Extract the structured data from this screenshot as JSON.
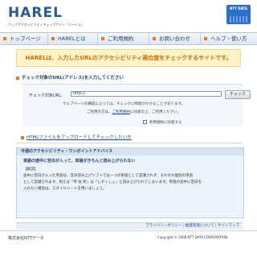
{
  "header": {
    "logo_text": "HAREL",
    "logo_subtitle": "ウェブアクセシビリティチェックサイト「ハーレル」",
    "brand_mark_text": "NTT DATA"
  },
  "nav": {
    "items": [
      {
        "label": "トップページ"
      },
      {
        "label": "HARELとは"
      },
      {
        "label": "ご利用規約"
      },
      {
        "label": "お問い合わせ"
      },
      {
        "label": "ヘルプ・使い方"
      }
    ]
  },
  "banner": {
    "text": "HARELは、入力したURLのアクセシビリティ適合度をチェックするサイトです。"
  },
  "url_form": {
    "heading": "チェック対象のURL(アドレス)を入力してください",
    "label": "チェック対象URL:",
    "value": "http://",
    "button_label": "チェック",
    "note1": "ウェブページの構成によっては、チェックに時間がかかることがあります。",
    "note2_prefix": "ご利用の方は、",
    "note2_link": "ご利用規約",
    "note2_suffix": "に同意の上、ご利用ください。",
    "agree_label": "利用規約に同意する"
  },
  "upload_link": {
    "text": "HTMLファイルをアップロードしてチェックしたい方"
  },
  "advice": {
    "heading": "今週のアクセシビリティ・ワンポイントアドバイス",
    "title": "単語の途中に空白が入って、単語がきちんと読み上げられない",
    "tag": "【解説】",
    "lines": [
      "途中に空白が入った単語は、音声読み上げソフトでは一つの単語として認識されず、それぞれ個別の単語",
      "として認識されます。例えば「市 役 所」は「しやくしょ」と読み上げられてしまいます。単語の途中に空白を",
      "入れたい場合は、スタイルシートを用いましょう。"
    ]
  },
  "footer_links": {
    "privacy": "プライバシーポリシー",
    "recommended": "推奨環境について",
    "sitemap": "サイトマップ",
    "separator": " | "
  },
  "footer": {
    "company": "株式会社NTTデータ",
    "copyright": "Copyright © 2008 NTT DATA CORPORATION"
  }
}
